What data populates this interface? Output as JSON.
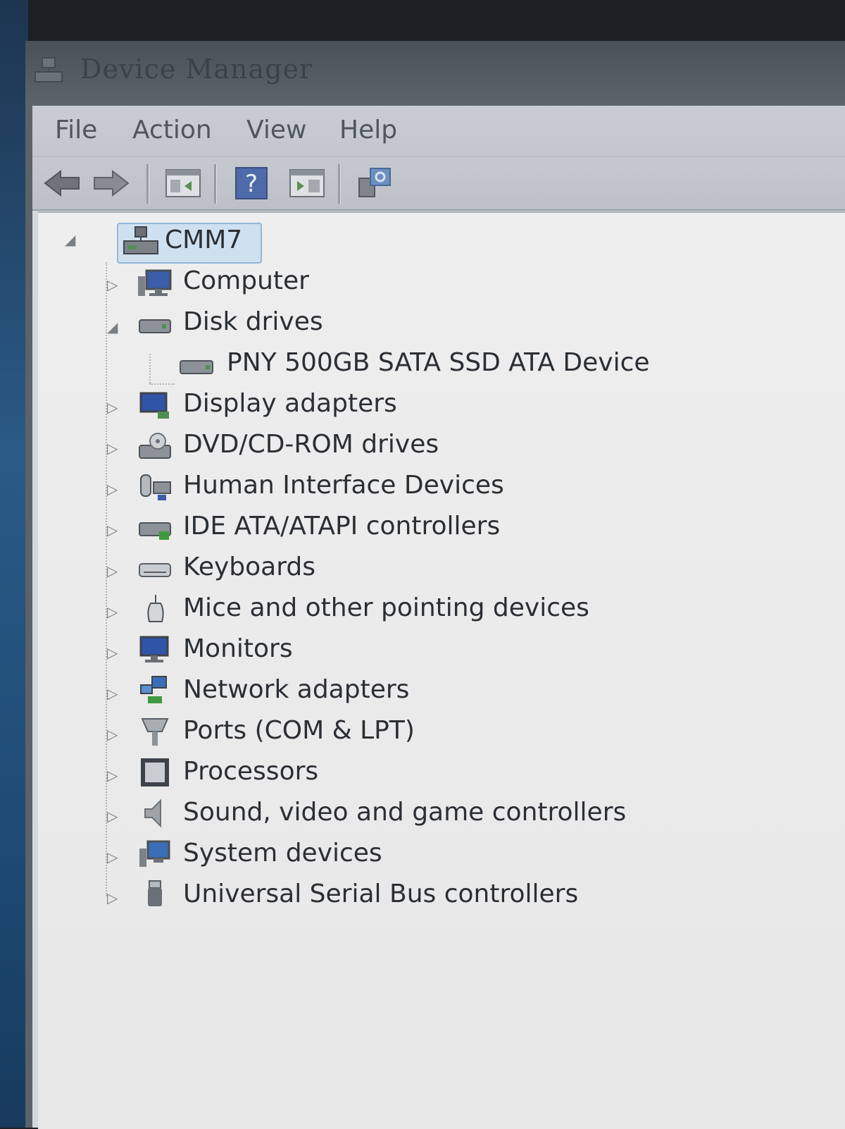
{
  "window": {
    "title": "Device Manager"
  },
  "menu": {
    "items": [
      "File",
      "Action",
      "View",
      "Help"
    ]
  },
  "toolbar": {
    "buttons": [
      "back-arrow-icon",
      "forward-arrow-icon",
      "show-hide-console-tree-icon",
      "help-icon",
      "properties-pane-icon",
      "scan-hardware-icon"
    ]
  },
  "tree": {
    "root": {
      "label": "CMM7",
      "expanded": true,
      "icon": "computer-network-icon"
    },
    "categories": [
      {
        "label": "Computer",
        "expanded": false,
        "icon": "computer-icon"
      },
      {
        "label": "Disk drives",
        "expanded": true,
        "icon": "disk-drive-icon",
        "children": [
          {
            "label": "PNY 500GB SATA SSD ATA Device",
            "icon": "disk-drive-icon"
          }
        ]
      },
      {
        "label": "Display adapters",
        "expanded": false,
        "icon": "display-adapter-icon"
      },
      {
        "label": "DVD/CD-ROM drives",
        "expanded": false,
        "icon": "dvd-drive-icon"
      },
      {
        "label": "Human Interface Devices",
        "expanded": false,
        "icon": "hid-icon"
      },
      {
        "label": "IDE ATA/ATAPI controllers",
        "expanded": false,
        "icon": "ide-controller-icon"
      },
      {
        "label": "Keyboards",
        "expanded": false,
        "icon": "keyboard-icon"
      },
      {
        "label": "Mice and other pointing devices",
        "expanded": false,
        "icon": "mouse-icon"
      },
      {
        "label": "Monitors",
        "expanded": false,
        "icon": "monitor-icon"
      },
      {
        "label": "Network adapters",
        "expanded": false,
        "icon": "network-adapter-icon"
      },
      {
        "label": "Ports (COM & LPT)",
        "expanded": false,
        "icon": "port-icon"
      },
      {
        "label": "Processors",
        "expanded": false,
        "icon": "processor-icon"
      },
      {
        "label": "Sound, video and game controllers",
        "expanded": false,
        "icon": "speaker-icon"
      },
      {
        "label": "System devices",
        "expanded": false,
        "icon": "system-device-icon"
      },
      {
        "label": "Universal Serial Bus controllers",
        "expanded": false,
        "icon": "usb-icon"
      }
    ]
  }
}
